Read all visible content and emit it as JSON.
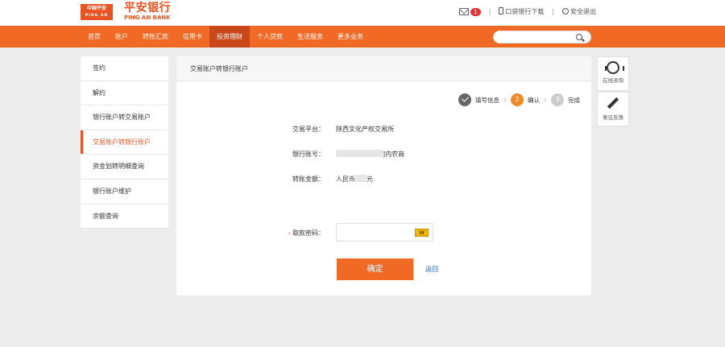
{
  "header": {
    "logo_line1": "中国平安",
    "logo_line2": "PING AN",
    "brand_cn": "平安银行",
    "brand_en": "PING AN BANK",
    "mail_count": "1",
    "download_label": "口袋银行下载",
    "separator": "|",
    "logout_label": "安全退出"
  },
  "nav": {
    "items": [
      "首页",
      "账户",
      "转账汇款",
      "信用卡",
      "投资理财",
      "个人贷款",
      "生活服务",
      "更多业务"
    ],
    "active_index": 4,
    "search_placeholder": ""
  },
  "sidebar": {
    "items": [
      "签约",
      "解约",
      "银行账户转交易账户",
      "交易账户转银行账户",
      "资金划转明细查询",
      "银行账户维护",
      "余额查询"
    ],
    "active_index": 3
  },
  "panel": {
    "title": "交易账户转银行账户",
    "steps": [
      {
        "label": "填写信息",
        "num": "1",
        "state": "done"
      },
      {
        "label": "确认",
        "num": "2",
        "state": "current"
      },
      {
        "label": "完成",
        "num": "3",
        "state": "todo"
      }
    ],
    "fields": [
      {
        "label": "交易平台：",
        "value": "陕西文化产权交易所"
      },
      {
        "label": "银行账号：",
        "value_prefix": "",
        "value_suffix": "]内农商"
      },
      {
        "label": "转账金额：",
        "value_prefix": "人民币",
        "value_suffix": "元"
      }
    ],
    "password_label": "取款密码：",
    "password_required_mark": "‹",
    "keyboard_icon_text": "W",
    "confirm_label": "确定",
    "back_label": "返回"
  },
  "tools": {
    "customer_service": "在线咨询",
    "feedback": "意见反馈"
  },
  "colors": {
    "brand_orange": "#f16a25",
    "nav_active": "#c8481a",
    "link_blue": "#1a66c6"
  }
}
